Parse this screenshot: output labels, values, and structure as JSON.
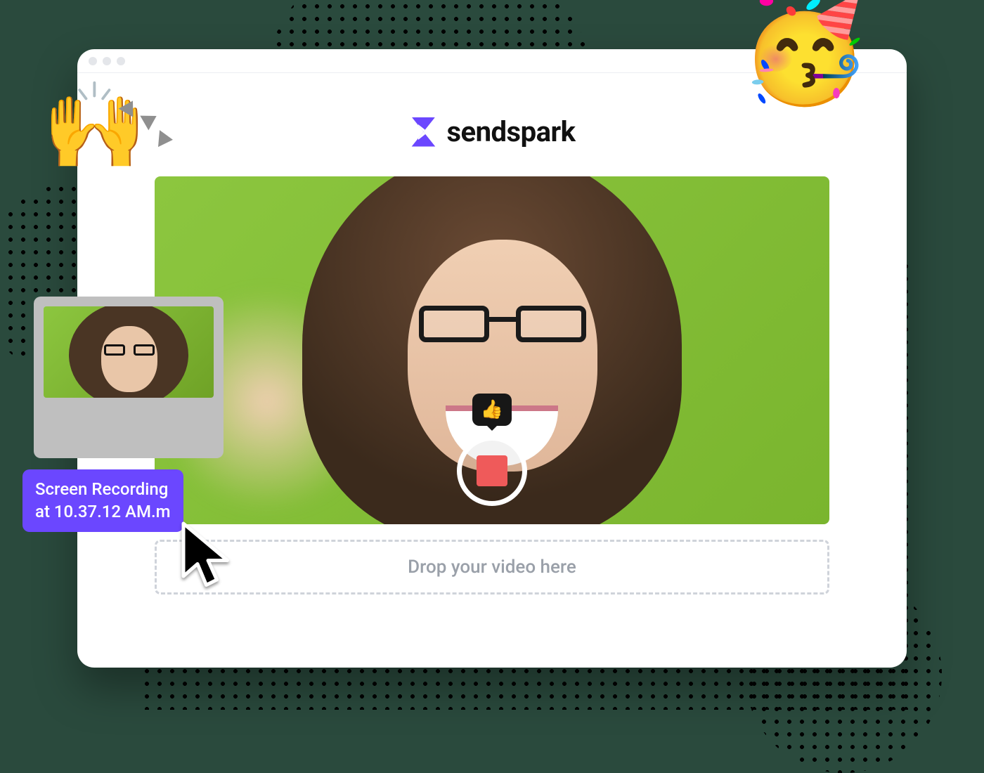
{
  "brand": {
    "name": "sendspark"
  },
  "video": {
    "tooltip_emoji": "👍",
    "recording": true
  },
  "dropzone": {
    "label": "Drop your video here"
  },
  "drag_file": {
    "line1": "Screen Recording",
    "line2": "at 10.37.12 AM.m"
  },
  "decor": {
    "hands_emoji": "🙌",
    "party_emoji": "🥳"
  }
}
